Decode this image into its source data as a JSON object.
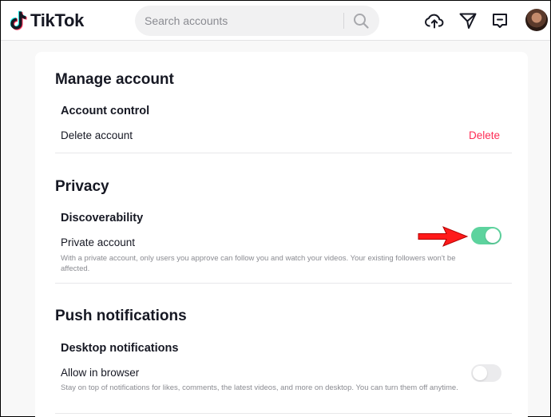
{
  "header": {
    "brand": "TikTok",
    "search": {
      "placeholder": "Search accounts",
      "value": ""
    }
  },
  "settings": {
    "manage_account": {
      "title": "Manage account",
      "account_control": {
        "subtitle": "Account control",
        "delete_row_label": "Delete account",
        "delete_link": "Delete"
      }
    },
    "privacy": {
      "title": "Privacy",
      "discoverability": {
        "subtitle": "Discoverability",
        "private_label": "Private account",
        "private_desc": "With a private account, only users you approve can follow you and watch your videos. Your existing followers won't be affected.",
        "private_enabled": true
      }
    },
    "push_notifications": {
      "title": "Push notifications",
      "desktop": {
        "subtitle": "Desktop notifications",
        "allow_label": "Allow in browser",
        "allow_desc": "Stay on top of notifications for likes, comments, the latest videos, and more on desktop. You can turn them off anytime.",
        "allow_enabled": false
      }
    }
  },
  "colors": {
    "accent_red": "#fe2c55",
    "toggle_on": "#5dd39e",
    "annotation_arrow": "#ff1a1a"
  }
}
